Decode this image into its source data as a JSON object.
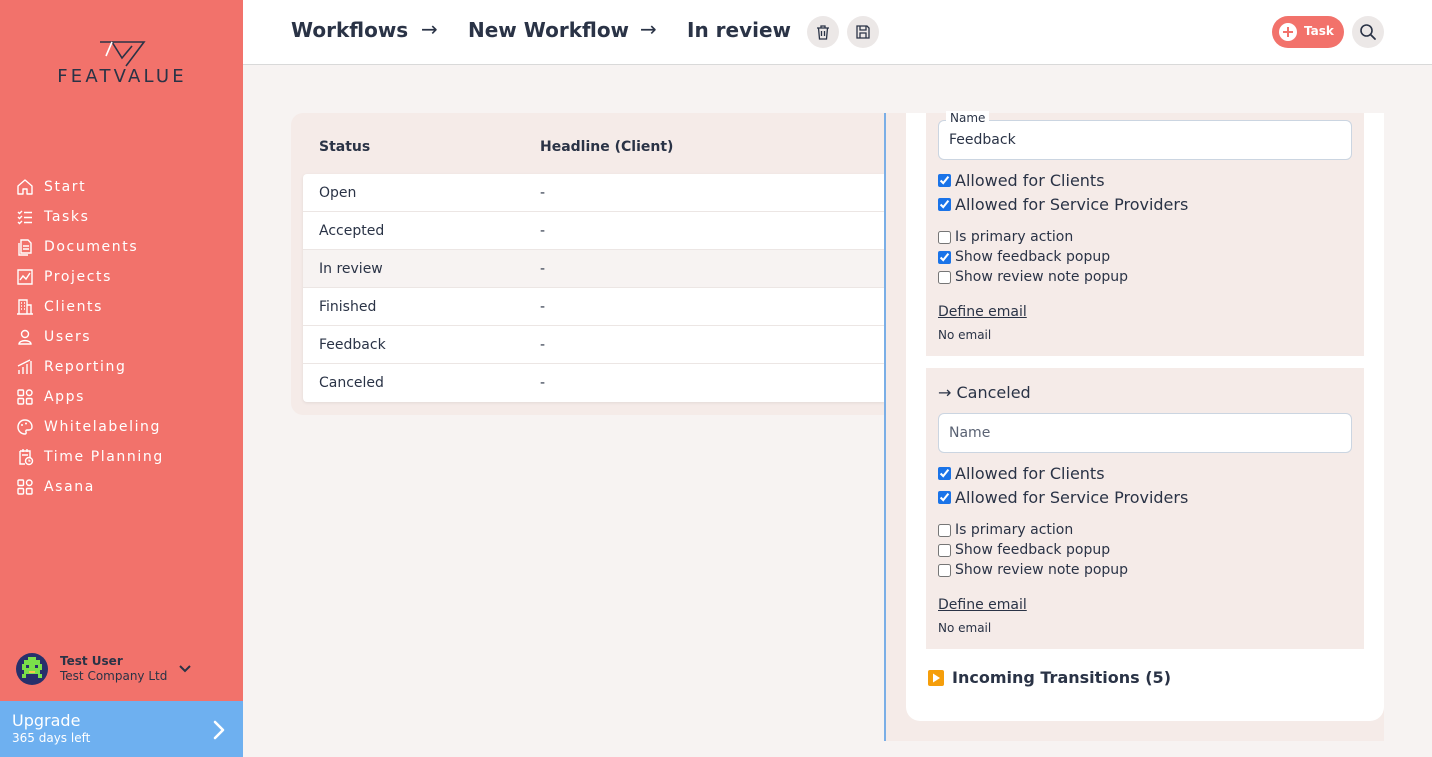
{
  "brand": {
    "name": "FEATVALUE"
  },
  "sidebar": {
    "items": [
      {
        "label": "Start",
        "icon": "home-icon"
      },
      {
        "label": "Tasks",
        "icon": "tasks-icon"
      },
      {
        "label": "Documents",
        "icon": "documents-icon"
      },
      {
        "label": "Projects",
        "icon": "projects-icon"
      },
      {
        "label": "Clients",
        "icon": "clients-icon"
      },
      {
        "label": "Users",
        "icon": "user-icon"
      },
      {
        "label": "Reporting",
        "icon": "reporting-icon"
      },
      {
        "label": "Apps",
        "icon": "apps-icon"
      },
      {
        "label": "Whitelabeling",
        "icon": "palette-icon"
      },
      {
        "label": "Time Planning",
        "icon": "time-planning-icon"
      },
      {
        "label": "Asana",
        "icon": "asana-icon"
      }
    ]
  },
  "user": {
    "name": "Test User",
    "company": "Test Company Ltd"
  },
  "upgrade": {
    "title": "Upgrade",
    "subtitle": "365 days left"
  },
  "header": {
    "breadcrumb": [
      "Workflows",
      "New Workflow",
      "In review"
    ],
    "separator": "→",
    "task_button": "Task"
  },
  "table": {
    "columns": [
      "Status",
      "Headline (Client)"
    ],
    "rows": [
      {
        "status": "Open",
        "headline": "-"
      },
      {
        "status": "Accepted",
        "headline": "-"
      },
      {
        "status": "In review",
        "headline": "-"
      },
      {
        "status": "Finished",
        "headline": "-"
      },
      {
        "status": "Feedback",
        "headline": "-"
      },
      {
        "status": "Canceled",
        "headline": "-"
      }
    ],
    "selected": "In review"
  },
  "transitions": [
    {
      "title": "",
      "name_label": "Name",
      "name_value": "Feedback",
      "allowed_clients": {
        "label": "Allowed for Clients",
        "checked": true
      },
      "allowed_providers": {
        "label": "Allowed for Service Providers",
        "checked": true
      },
      "primary_action": {
        "label": "Is primary action",
        "checked": false
      },
      "feedback_popup": {
        "label": "Show feedback popup",
        "checked": true
      },
      "review_popup": {
        "label": "Show review note popup",
        "checked": false
      },
      "define_email": "Define email",
      "email_status": "No email"
    },
    {
      "title": "→ Canceled",
      "name_placeholder": "Name",
      "name_value": "",
      "allowed_clients": {
        "label": "Allowed for Clients",
        "checked": true
      },
      "allowed_providers": {
        "label": "Allowed for Service Providers",
        "checked": true
      },
      "primary_action": {
        "label": "Is primary action",
        "checked": false
      },
      "feedback_popup": {
        "label": "Show feedback popup",
        "checked": false
      },
      "review_popup": {
        "label": "Show review note popup",
        "checked": false
      },
      "define_email": "Define email",
      "email_status": "No email"
    }
  ],
  "incoming": {
    "label": "Incoming Transitions (5)"
  },
  "colors": {
    "sidebar": "#f2726b",
    "upgrade": "#6eb0f0",
    "accent": "#1a73e8",
    "panel_tint": "#f5ebe8"
  }
}
